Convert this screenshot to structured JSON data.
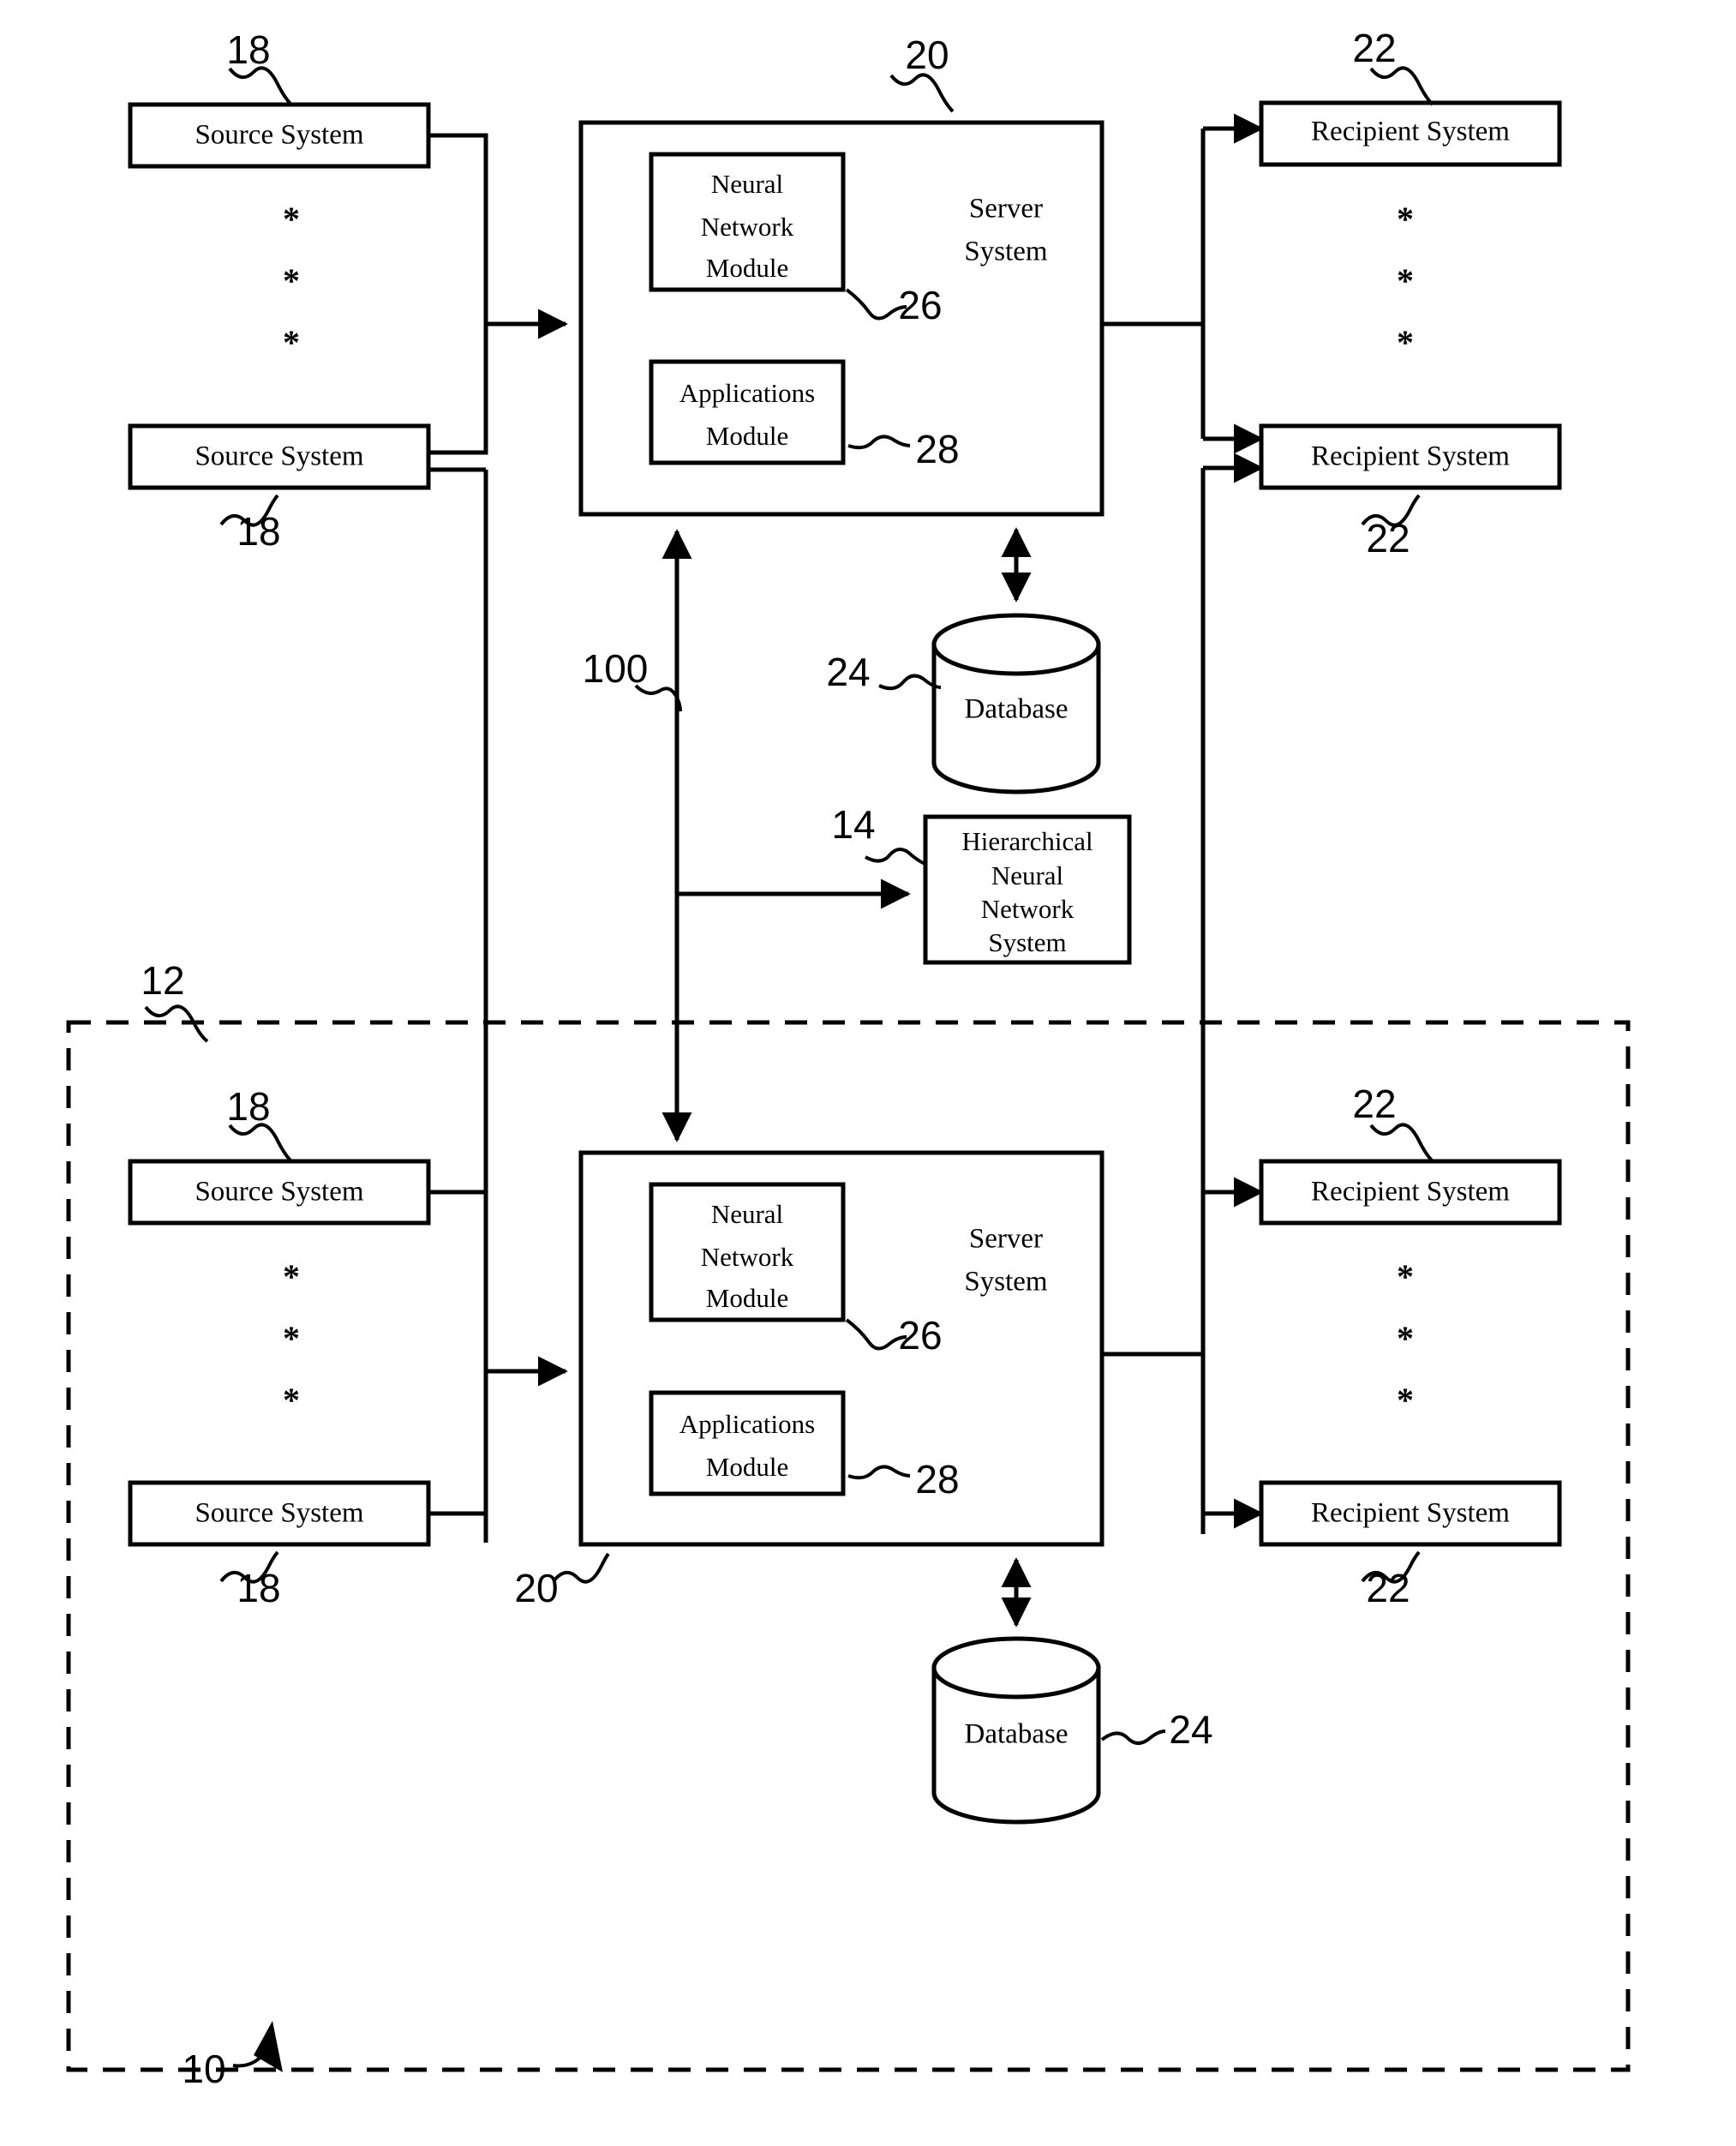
{
  "figure": {
    "title": "Hierarchical neural network system block diagram",
    "reference_numeral": "10"
  },
  "labels": {
    "source_system": "Source System",
    "recipient_system": "Recipient System",
    "server_system_line1": "Server",
    "server_system_line2": "System",
    "neural_network_module_line1": "Neural",
    "neural_network_module_line2": "Network",
    "neural_network_module_line3": "Module",
    "applications_module_line1": "Applications",
    "applications_module_line2": "Module",
    "database": "Database",
    "hierarchical_line1": "Hierarchical",
    "hierarchical_line2": "Neural",
    "hierarchical_line3": "Network",
    "hierarchical_line4": "System",
    "star": "*"
  },
  "refs": {
    "system_10": "10",
    "subsystem_12": "12",
    "hierarchical_14": "14",
    "source_18": "18",
    "server_20": "20",
    "recipient_22": "22",
    "database_24": "24",
    "neural_module_26": "26",
    "applications_module_28": "28",
    "link_100": "100"
  },
  "top_tier": {
    "source_systems": [
      {
        "label": "Source System",
        "ref": "18"
      },
      {
        "label": "Source System",
        "ref": "18"
      }
    ],
    "server": {
      "name_line1": "Server",
      "name_line2": "System",
      "ref": "20",
      "modules": [
        {
          "lines": [
            "Neural",
            "Network",
            "Module"
          ],
          "ref": "26"
        },
        {
          "lines": [
            "Applications",
            "Module"
          ],
          "ref": "28"
        }
      ]
    },
    "recipient_systems": [
      {
        "label": "Recipient System",
        "ref": "22"
      },
      {
        "label": "Recipient System",
        "ref": "22"
      }
    ],
    "database": {
      "label": "Database",
      "ref": "24"
    }
  },
  "middle": {
    "hierarchical_neural_network_system": {
      "lines": [
        "Hierarchical",
        "Neural",
        "Network",
        "System"
      ],
      "ref": "14"
    },
    "link": {
      "ref": "100"
    }
  },
  "bottom_tier": {
    "boundary_ref": "12",
    "source_systems": [
      {
        "label": "Source System",
        "ref": "18"
      },
      {
        "label": "Source System",
        "ref": "18"
      }
    ],
    "server": {
      "name_line1": "Server",
      "name_line2": "System",
      "ref": "20",
      "modules": [
        {
          "lines": [
            "Neural",
            "Network",
            "Module"
          ],
          "ref": "26"
        },
        {
          "lines": [
            "Applications",
            "Module"
          ],
          "ref": "28"
        }
      ]
    },
    "recipient_systems": [
      {
        "label": "Recipient System",
        "ref": "22"
      },
      {
        "label": "Recipient System",
        "ref": "22"
      }
    ],
    "database": {
      "label": "Database",
      "ref": "24"
    }
  },
  "colors": {
    "ink": "#000000",
    "paper": "#ffffff"
  }
}
